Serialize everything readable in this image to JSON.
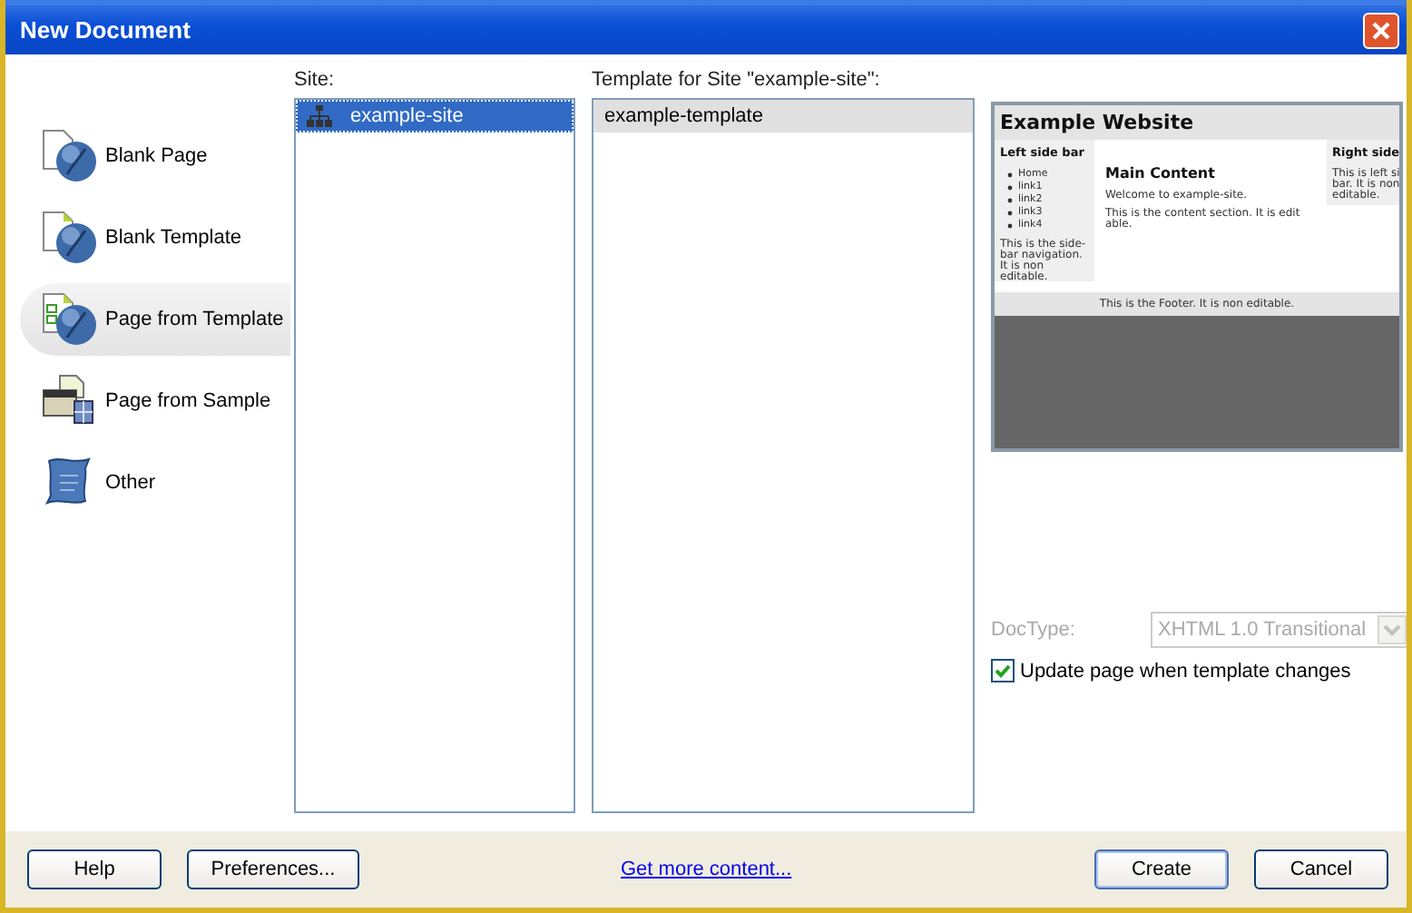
{
  "window": {
    "title": "New Document"
  },
  "categories": [
    {
      "label": "Blank Page",
      "selected": false
    },
    {
      "label": "Blank Template",
      "selected": false
    },
    {
      "label": "Page from Template",
      "selected": true
    },
    {
      "label": "Page from Sample",
      "selected": false
    },
    {
      "label": "Other",
      "selected": false
    }
  ],
  "site": {
    "label": "Site:",
    "items": [
      {
        "label": "example-site",
        "selected": true
      }
    ]
  },
  "templates": {
    "label": "Template for Site \"example-site\":",
    "items": [
      {
        "label": "example-template",
        "selected": true
      }
    ]
  },
  "preview": {
    "title": "Example Website",
    "left_heading": "Left side bar",
    "links": [
      "Home",
      "link1",
      "link2",
      "link3",
      "link4"
    ],
    "left_text": "This is the side-bar navigation. It is non editable.",
    "main_heading": "Main Content",
    "welcome": "Welcome to example-site.",
    "main_text": "This is the content section. It is edit able.",
    "right_heading": "Right side",
    "right_lines": [
      "This is left si",
      "bar. It is non",
      "editable."
    ],
    "footer": "This is the Footer. It is non editable."
  },
  "doctype": {
    "label": "DocType:",
    "value": "XHTML 1.0 Transitional",
    "disabled": true
  },
  "update_checkbox": {
    "label": "Update page when template changes",
    "checked": true
  },
  "buttons": {
    "help": "Help",
    "preferences": "Preferences...",
    "link": "Get more content...",
    "create": "Create",
    "cancel": "Cancel"
  }
}
